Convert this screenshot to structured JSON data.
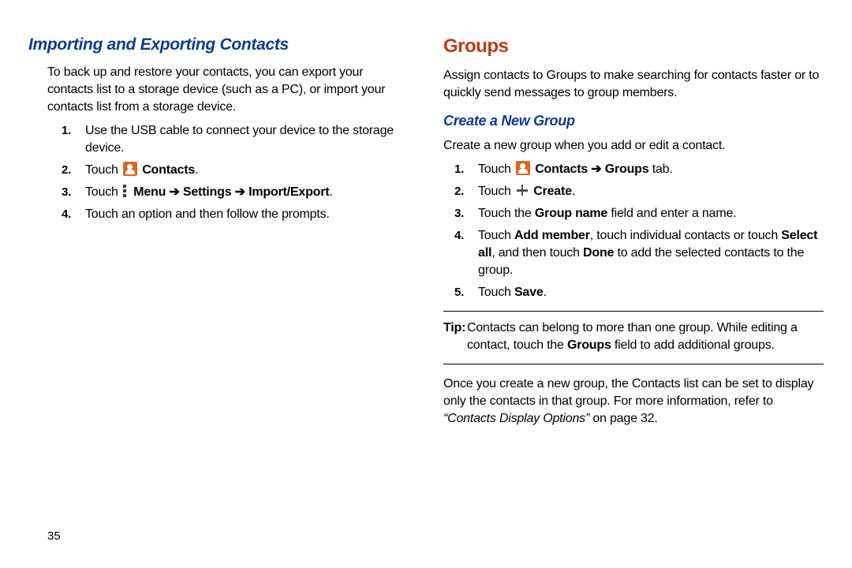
{
  "left": {
    "h2": "Importing and Exporting Contacts",
    "intro": "To back up and restore your contacts, you can export your contacts list to a storage device (such as a PC), or import your contacts list from a storage device.",
    "step1": "Use the USB cable to connect your device to the storage device.",
    "step2_touch": "Touch ",
    "contacts_label": "Contacts",
    "step3_touch": "Touch ",
    "menu_path": "Menu ➔ Settings ➔ Import/Export",
    "step4": "Touch an option and then follow the prompts."
  },
  "right": {
    "h1": "Groups",
    "intro": "Assign contacts to Groups to make searching for contacts faster or to quickly send messages to group members.",
    "h3": "Create a New Group",
    "sub_intro": "Create a new group when you add or edit a contact.",
    "s1_touch": "Touch ",
    "s1_rest": "Contacts ➔ Groups",
    "s1_tab": " tab.",
    "s2_touch": "Touch ",
    "s2_create": "Create",
    "s3_a": "Touch the ",
    "s3_b": "Group name",
    "s3_c": " field and enter a name.",
    "s4_a": "Touch ",
    "s4_b": "Add member",
    "s4_c": ", touch individual contacts or touch ",
    "s4_d": "Select all",
    "s4_e": ", and then touch ",
    "s4_f": "Done",
    "s4_g": " to add the selected contacts to the group.",
    "s5_a": "Touch ",
    "s5_b": "Save",
    "tip_label": "Tip:",
    "tip_a": "Contacts can belong to more than one group. While editing a contact, touch the ",
    "tip_b": "Groups",
    "tip_c": " field to add additional groups.",
    "after_a": "Once you create a new group, the Contacts list can be set to display only the contacts in that group. For more information, refer to ",
    "after_b": "“Contacts Display Options”",
    "after_c": " on page 32."
  },
  "pagenum": "35"
}
